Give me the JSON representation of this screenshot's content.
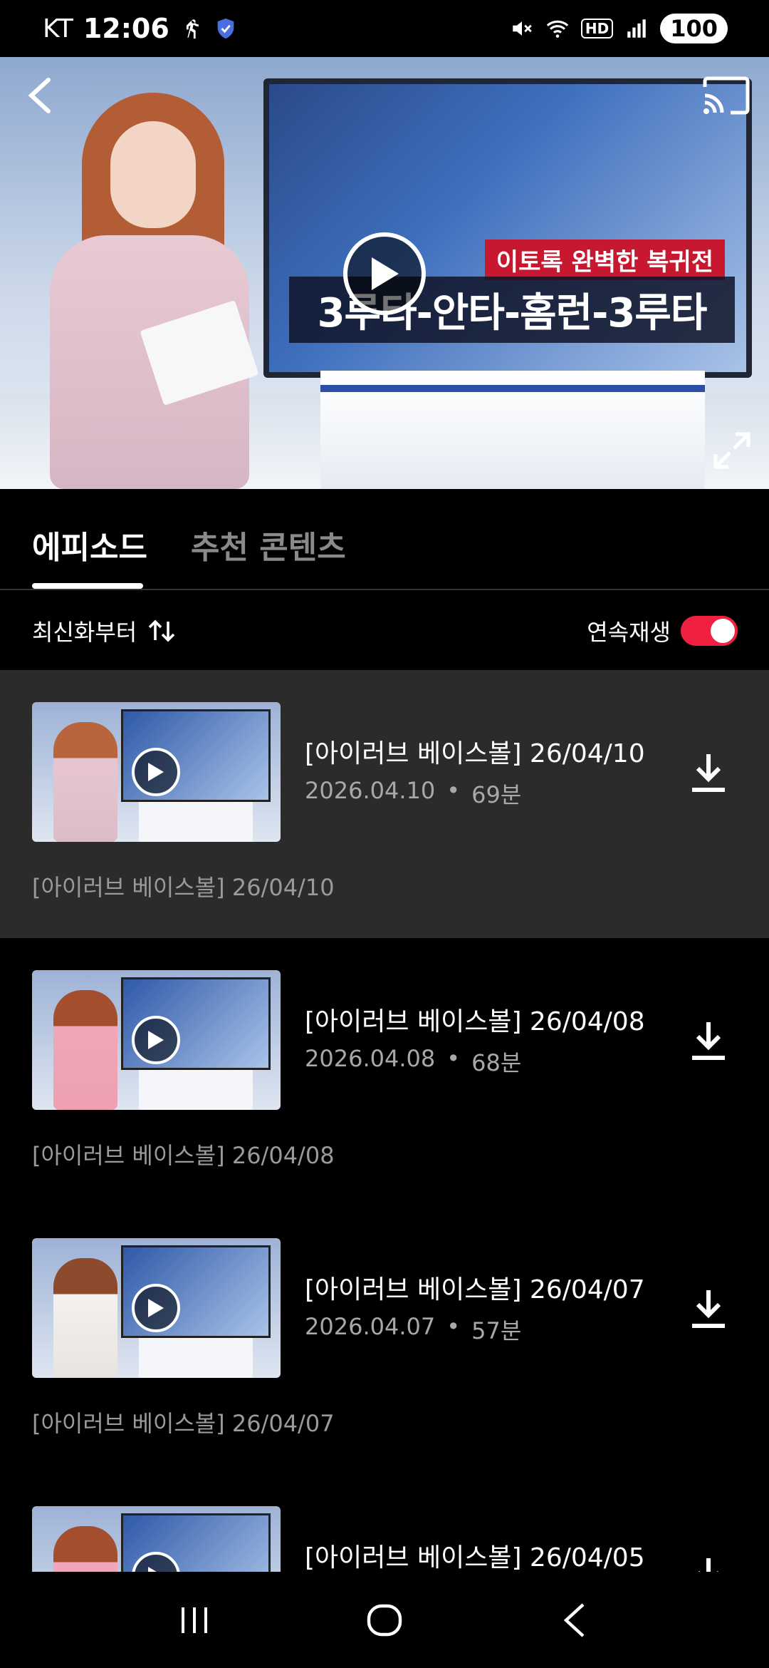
{
  "status_bar": {
    "carrier": "KT",
    "time": "12:06",
    "battery": "100",
    "network_badge": "HD",
    "icons": [
      "runner-icon",
      "shield-app-icon",
      "mute-icon",
      "wifi-icon",
      "hd-icon",
      "signal-icon",
      "battery-icon"
    ]
  },
  "player": {
    "monitor_tag": "이토록 완벽한 복귀전",
    "monitor_headline": "3루타-안타-홈런-3루타",
    "icons": [
      "back-icon",
      "cast-icon",
      "play-icon",
      "fullscreen-icon"
    ]
  },
  "tabs": [
    {
      "label": "에피소드",
      "active": true
    },
    {
      "label": "추천 콘텐츠",
      "active": false
    }
  ],
  "sort": {
    "label": "최신화부터",
    "icon": "sort-arrows-icon"
  },
  "autoplay": {
    "label": "연속재생",
    "enabled": true,
    "color": "#f0213f"
  },
  "episodes": [
    {
      "title": "[아이러브 베이스볼] 26/04/10",
      "date": "2026.04.10",
      "separator": "•",
      "duration": "69분",
      "desc": "[아이러브 베이스볼] 26/04/10",
      "selected": true
    },
    {
      "title": "[아이러브 베이스볼] 26/04/08",
      "date": "2026.04.08",
      "separator": "•",
      "duration": "68분",
      "desc": "[아이러브 베이스볼] 26/04/08",
      "selected": false
    },
    {
      "title": "[아이러브 베이스볼] 26/04/07",
      "date": "2026.04.07",
      "separator": "•",
      "duration": "57분",
      "desc": "[아이러브 베이스볼] 26/04/07",
      "selected": false
    },
    {
      "title": "[아이러브 베이스볼] 26/04/05",
      "selected": false
    }
  ],
  "nav_bar": {
    "icons": [
      "recent-apps-icon",
      "home-icon",
      "back-nav-icon"
    ]
  }
}
